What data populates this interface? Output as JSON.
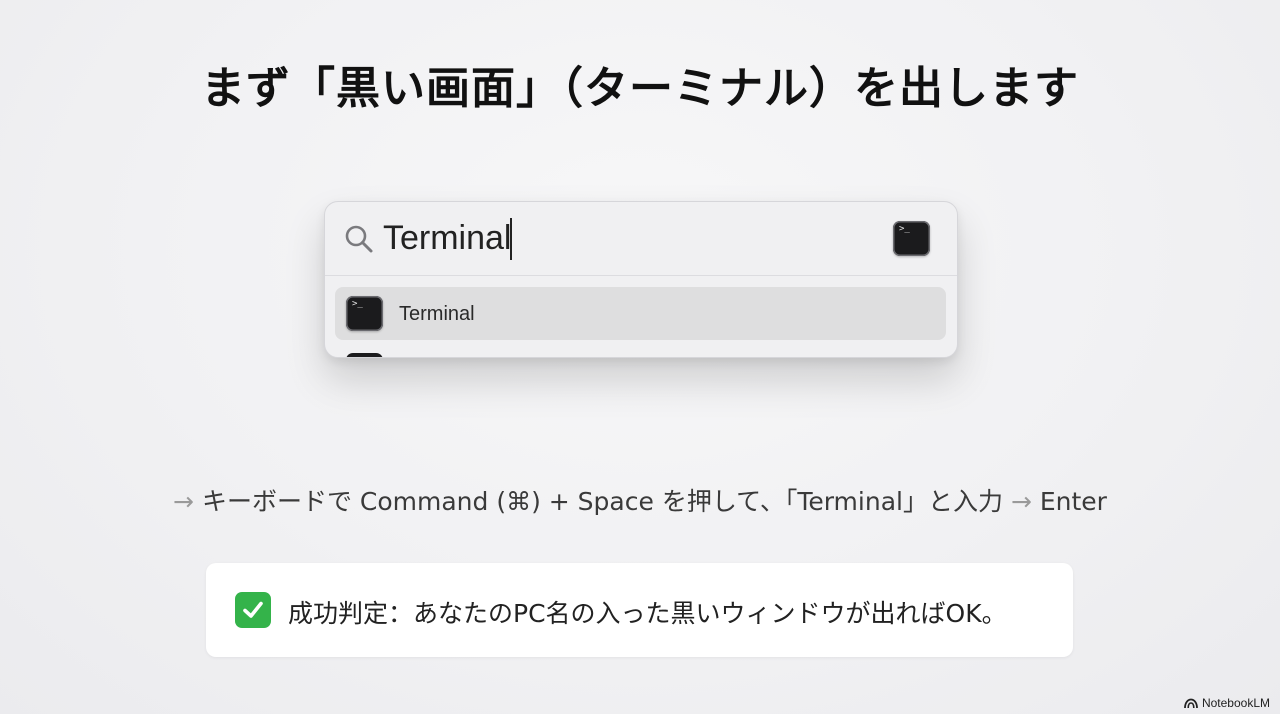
{
  "slide": {
    "title": "まず「黒い画面」（ターミナル）を出します"
  },
  "spotlight": {
    "search_value": "Terminal",
    "search_icon": "magnifying-glass-icon",
    "top_app_icon": "terminal-app-icon",
    "results": [
      {
        "label": "Terminal",
        "icon": "terminal-app-icon",
        "selected": true
      }
    ],
    "icon_glyph": ">_"
  },
  "instruction": {
    "arrow": "→",
    "text_1": "キーボードで Command (⌘) + Space を押して、「Terminal」と入力",
    "text_2": "Enter"
  },
  "success": {
    "icon": "check-mark-button-icon",
    "text": "成功判定：あなたのPC名の入った黒いウィンドウが出ればOK。",
    "icon_color": "#34b34a"
  },
  "watermark": {
    "label": "NotebookLM",
    "icon": "notebooklm-logo-icon"
  }
}
